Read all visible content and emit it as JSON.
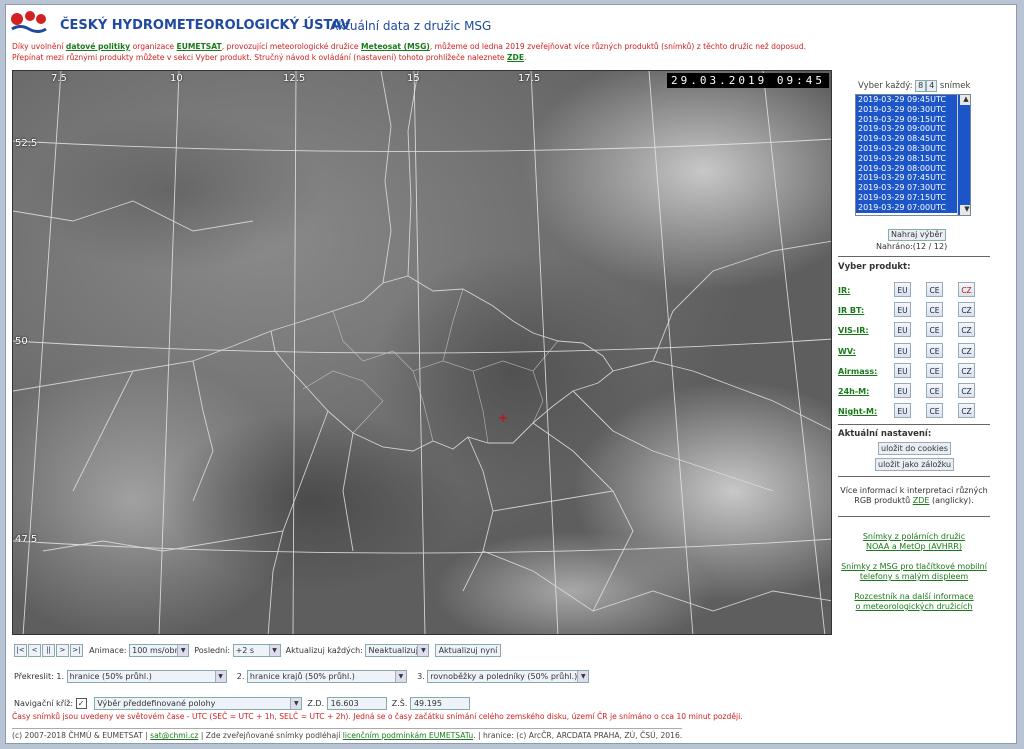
{
  "header": {
    "title": "ČESKÝ HYDROMETEOROLOGICKÝ ÚSTAV",
    "dash": "-",
    "subtitle": "Aktuální data z družic MSG"
  },
  "intro": {
    "p1": "Díky uvolnění",
    "link1": "datové politiky",
    "p2": "organizace",
    "link2": "EUMETSAT",
    "p3": ", provozující meteorologické družice",
    "link3": "Meteosat (MSG)",
    "p4": ", můžeme od ledna 2019 zveřejňovat více různých produktů (snímků) z těchto družic než doposud.",
    "line2": "Přepínat mezi různými produkty můžete v sekci Vyber produkt. Stručný návod k ovládání (nastavení) tohoto prohlížeče naleznete",
    "link4": "ZDE",
    "dot": "."
  },
  "map": {
    "timestamp": "29.03.2019 09:45",
    "lon_labels": [
      "7.5",
      "10",
      "12.5",
      "15",
      "17.5"
    ],
    "lat_labels": [
      "52.5",
      "50",
      "47.5"
    ]
  },
  "panel": {
    "vyber_kazdy": "Vyber každý:",
    "n1": "8",
    "n2": "4",
    "snimek": "snímek",
    "times": [
      "2019-03-29 09:45UTC",
      "2019-03-29 09:30UTC",
      "2019-03-29 09:15UTC",
      "2019-03-29 09:00UTC",
      "2019-03-29 08:45UTC",
      "2019-03-29 08:30UTC",
      "2019-03-29 08:15UTC",
      "2019-03-29 08:00UTC",
      "2019-03-29 07:45UTC",
      "2019-03-29 07:30UTC",
      "2019-03-29 07:15UTC",
      "2019-03-29 07:00UTC"
    ],
    "nahraj": "Nahraj výběr",
    "nahrano": "Nahráno:(12 / 12)",
    "vyber_produkt": "Vyber produkt:",
    "products": [
      {
        "name": "IR:",
        "eu": "EU",
        "ce": "CE",
        "cz": "CZ",
        "selected": "cz"
      },
      {
        "name": "IR BT:",
        "eu": "EU",
        "ce": "CE",
        "cz": "CZ",
        "selected": ""
      },
      {
        "name": "VIS-IR:",
        "eu": "EU",
        "ce": "CE",
        "cz": "CZ",
        "selected": ""
      },
      {
        "name": "WV:",
        "eu": "EU",
        "ce": "CE",
        "cz": "CZ",
        "selected": ""
      },
      {
        "name": "Airmass:",
        "eu": "EU",
        "ce": "CE",
        "cz": "CZ",
        "selected": ""
      },
      {
        "name": "24h-M:",
        "eu": "EU",
        "ce": "CE",
        "cz": "CZ",
        "selected": ""
      },
      {
        "name": "Night-M:",
        "eu": "EU",
        "ce": "CE",
        "cz": "CZ",
        "selected": ""
      }
    ],
    "aktualni": "Aktuální nastavení:",
    "cookies": "uložit do cookies",
    "zalozka": "uložit jako záložku",
    "info1": "Více informací k interpretaci různých",
    "info2": "RGB produktů",
    "info_link": "ZDE",
    "info3": "(anglicky).",
    "links": [
      {
        "l1": "Snímky z polárních družic",
        "l2": "NOAA a MetOp (AVHRR)"
      },
      {
        "l1": "Snímky z MSG pro tlačítkové mobilní",
        "l2": "telefony s malým displeem"
      },
      {
        "l1": "Rozcestník na další informace",
        "l2": "o meteorologických družicích"
      }
    ]
  },
  "controls": {
    "nav": [
      "|<",
      "<",
      "||",
      ">",
      ">|"
    ],
    "animace_lbl": "Animace:",
    "animace_val": "100 ms/obr",
    "posledni_lbl": "Poslední:",
    "posledni_val": "+2 s",
    "aktualizuj_lbl": "Aktualizuj každých:",
    "aktualizuj_val": "Neaktualizuj",
    "aktualizuj_btn": "Aktualizuj nyní",
    "prekreslit_lbl": "Překreslit: 1.",
    "p1_val": "hranice (50% průhl.)",
    "n2": "2.",
    "p2_val": "hranice krajů (50% průhl.)",
    "n3": "3.",
    "p3_val": "rovnoběžky a poledníky (50% průhl.)",
    "kriz_lbl": "Navigační kříž:",
    "kriz_select": "Výběr předdefinované polohy",
    "zd_lbl": "Z.D.",
    "zd_val": "16.603",
    "zs_lbl": "Z.Š.",
    "zs_val": "49.195"
  },
  "note": "Časy snímků jsou uvedeny ve světovém čase - UTC (SEČ = UTC + 1h, SELČ = UTC + 2h). Jedná se o časy začátku snímání celého zemského disku, území ČR je snímáno o cca 10 minut později.",
  "footer": {
    "f1": "(c) 2007-2018 ČHMÚ & EUMETSAT |",
    "email": "sat@chmi.cz",
    "f2": "| Zde zveřejňované snímky podléhají",
    "lic": "licenčním podmínkám EUMETSATu",
    "f3": ". | hranice: (c) ArcČR, ARCDATA PRAHA, ZÚ, ČSÚ, 2016."
  },
  "colors": {
    "title": "#1f4aa0",
    "link": "#1a7a1a",
    "warn": "#d02020",
    "list": "#1c55c7"
  }
}
